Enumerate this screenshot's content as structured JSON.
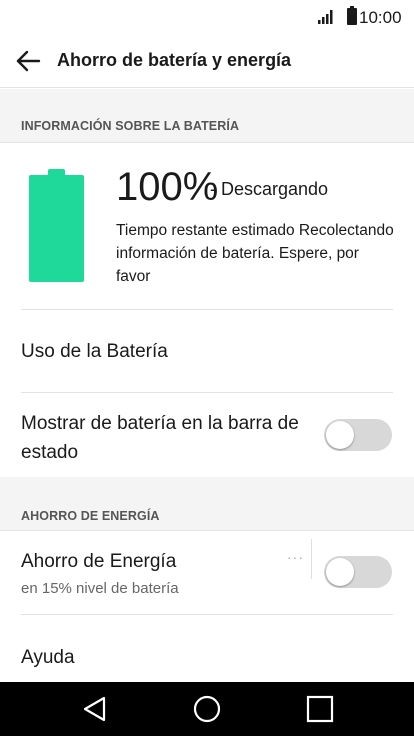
{
  "status_bar": {
    "time": "10:00",
    "icons": [
      "signal-icon",
      "battery-icon"
    ]
  },
  "app_bar": {
    "title": "Ahorro de batería y energía",
    "back_icon": "back-arrow-icon"
  },
  "sections": {
    "battery_info": {
      "header": "INFORMACIÓN SOBRE LA BATERÍA"
    },
    "power_saving": {
      "header": "AHORRO DE ENERGÍA"
    }
  },
  "battery": {
    "percent": "100%",
    "level": 1.0,
    "state": "- Descargando",
    "estimate": "Tiempo restante estimado Recolectando información de batería. Espere, por favor",
    "color": "#1ed99a"
  },
  "rows": {
    "usage": {
      "label": "Uso de la Batería"
    },
    "show_in_statusbar": {
      "label": "Mostrar de batería en la barra de estado",
      "toggle_on": false
    },
    "power_saver": {
      "label": "Ahorro de Energía",
      "sub": "en 15% nivel de batería",
      "more": "···",
      "toggle_on": false
    },
    "help": {
      "label": "Ayuda"
    }
  },
  "navigation": {
    "buttons": [
      "back-triangle-icon",
      "home-circle-icon",
      "recents-square-icon"
    ]
  },
  "colors": {
    "accent_battery": "#1ed99a",
    "toggle_off_track": "#d8d8d8",
    "section_bg": "#f4f4f4",
    "navbar_bg": "#000000"
  }
}
